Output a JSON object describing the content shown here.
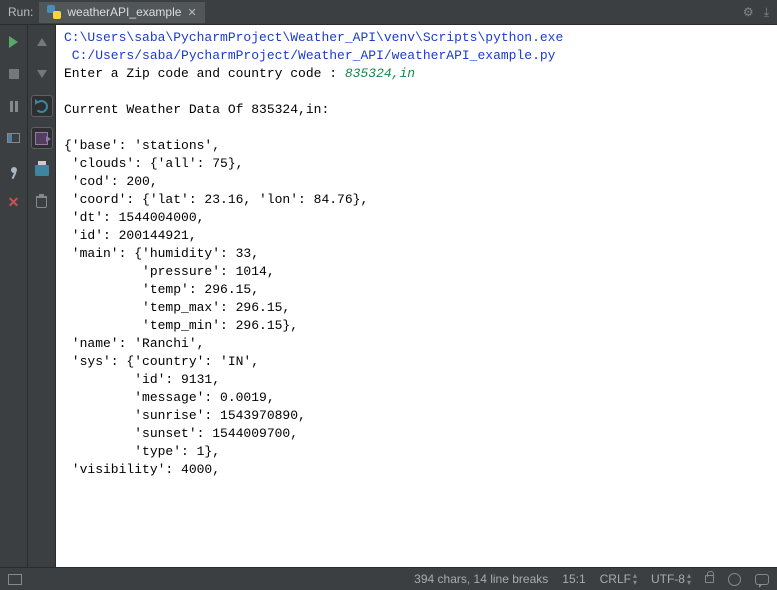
{
  "header": {
    "run_label": "Run:",
    "tab_title": "weatherAPI_example"
  },
  "console": {
    "path1": "C:\\Users\\saba\\PycharmProject\\Weather_API\\venv\\Scripts\\python.exe",
    "path2": " C:/Users/saba/PycharmProject/Weather_API/weatherAPI_example.py",
    "prompt_label": "Enter a Zip code and country code : ",
    "prompt_input": "835324,in",
    "heading": "Current Weather Data Of 835324,in:",
    "lines": [
      "{'base': 'stations',",
      " 'clouds': {'all': 75},",
      " 'cod': 200,",
      " 'coord': {'lat': 23.16, 'lon': 84.76},",
      " 'dt': 1544004000,",
      " 'id': 200144921,",
      " 'main': {'humidity': 33,",
      "          'pressure': 1014,",
      "          'temp': 296.15,",
      "          'temp_max': 296.15,",
      "          'temp_min': 296.15},",
      " 'name': 'Ranchi',",
      " 'sys': {'country': 'IN',",
      "         'id': 9131,",
      "         'message': 0.0019,",
      "         'sunrise': 1543970890,",
      "         'sunset': 1544009700,",
      "         'type': 1},",
      " 'visibility': 4000,"
    ]
  },
  "status": {
    "chars": "394 chars, 14 line breaks",
    "line_col": "15:1",
    "line_ending": "CRLF",
    "encoding": "UTF-8"
  }
}
